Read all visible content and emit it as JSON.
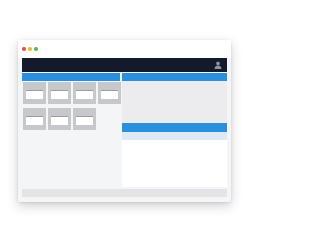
{
  "window": {
    "controls": [
      {
        "name": "close",
        "color": "#e9504a"
      },
      {
        "name": "minimize",
        "color": "#f0b72f"
      },
      {
        "name": "maximize",
        "color": "#57c04a"
      }
    ]
  },
  "topnav": {
    "background": "#141a2b",
    "user_icon": "user-icon"
  },
  "accent_color": "#2a8fdc",
  "tiles": {
    "count": 7,
    "icon": "document-thumbnail-icon"
  }
}
